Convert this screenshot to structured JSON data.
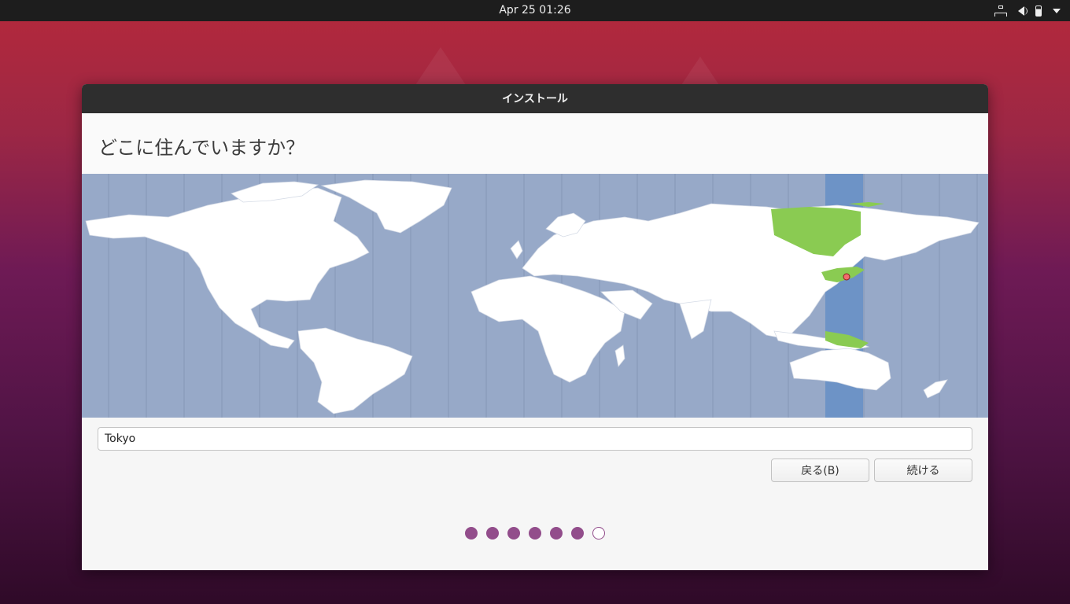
{
  "topbar": {
    "clock": "Apr 25  01:26",
    "tray_icons": [
      "network-icon",
      "volume-icon",
      "battery-icon",
      "system-menu-chevron-icon"
    ]
  },
  "window": {
    "title": "インストール",
    "heading": "どこに住んでいますか？",
    "timezone_value": "Tokyo",
    "buttons": {
      "back": "戻る(B)",
      "continue": "続ける"
    },
    "progress": {
      "total_steps": 7,
      "completed_steps": 6
    }
  },
  "map": {
    "selected_city": "Tokyo",
    "colors": {
      "ocean": "#97a9c8",
      "land": "#ffffff",
      "selected_zone_band": "#6d93c6",
      "selected_zone_land": "#8acb52",
      "marker": "#f26d6d"
    }
  },
  "colors": {
    "accent": "#924d8b",
    "titlebar": "#2e2e2e",
    "topbar": "#1d1d1d"
  }
}
